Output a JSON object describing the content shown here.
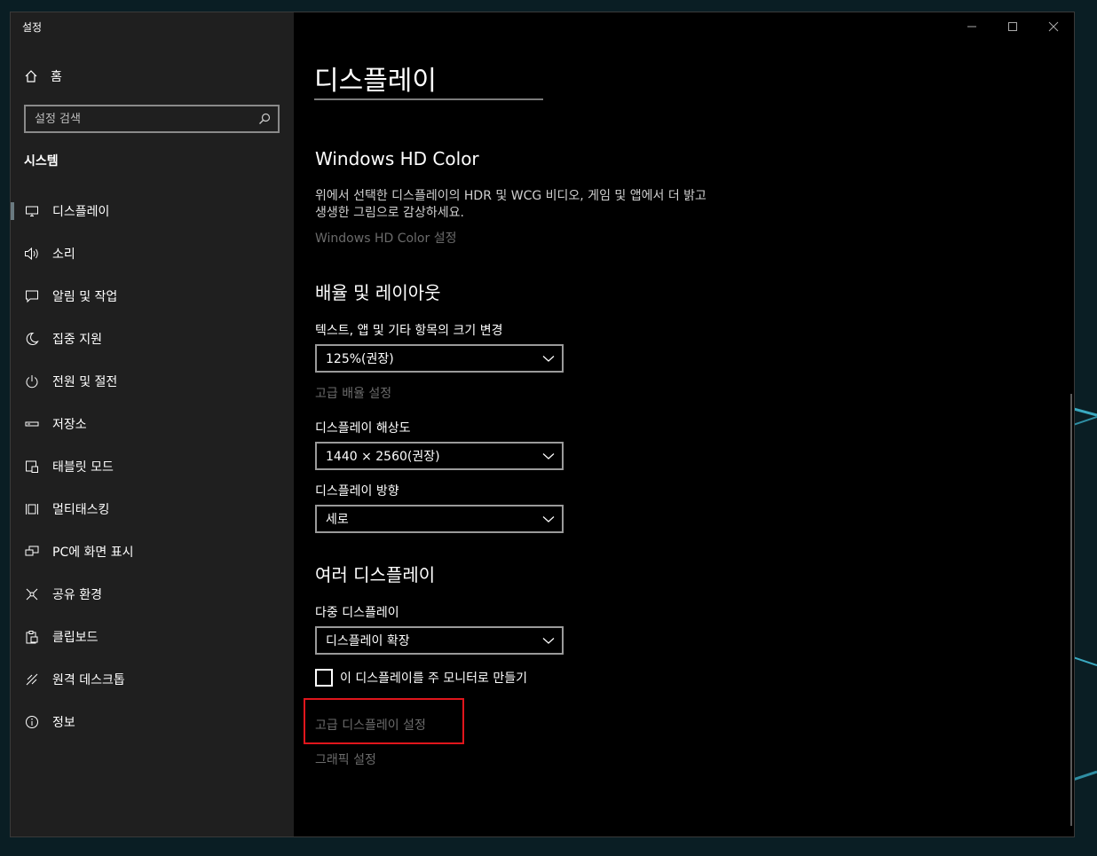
{
  "window": {
    "title": "설정"
  },
  "sidebar": {
    "home_label": "홈",
    "search_placeholder": "설정 검색",
    "section": "시스템",
    "items": [
      {
        "label": "디스플레이",
        "icon": "monitor-icon",
        "active": true
      },
      {
        "label": "소리",
        "icon": "speaker-icon"
      },
      {
        "label": "알림 및 작업",
        "icon": "notification-icon"
      },
      {
        "label": "집중 지원",
        "icon": "moon-icon"
      },
      {
        "label": "전원 및 절전",
        "icon": "power-icon"
      },
      {
        "label": "저장소",
        "icon": "storage-icon"
      },
      {
        "label": "태블릿 모드",
        "icon": "tablet-icon"
      },
      {
        "label": "멀티태스킹",
        "icon": "multitask-icon"
      },
      {
        "label": "PC에 화면 표시",
        "icon": "project-icon"
      },
      {
        "label": "공유 환경",
        "icon": "share-icon"
      },
      {
        "label": "클립보드",
        "icon": "clipboard-icon"
      },
      {
        "label": "원격 데스크톱",
        "icon": "remote-desktop-icon"
      },
      {
        "label": "정보",
        "icon": "info-icon"
      }
    ]
  },
  "main": {
    "title": "디스플레이",
    "hdr": {
      "heading": "Windows HD Color",
      "description": "위에서 선택한 디스플레이의 HDR 및 WCG 비디오, 게임 및 앱에서 더 밝고 생생한 그림으로 감상하세요.",
      "link": "Windows HD Color 설정"
    },
    "scale": {
      "heading": "배율 및 레이아웃",
      "text_size_label": "텍스트, 앱 및 기타 항목의 크기 변경",
      "text_size_value": "125%(권장)",
      "advanced_scaling_link": "고급 배율 설정",
      "resolution_label": "디스플레이 해상도",
      "resolution_value": "1440 × 2560(권장)",
      "orientation_label": "디스플레이 방향",
      "orientation_value": "세로"
    },
    "multi": {
      "heading": "여러 디스플레이",
      "multi_label": "다중 디스플레이",
      "multi_value": "디스플레이 확장",
      "main_display_checkbox": "이 디스플레이를 주 모니터로 만들기",
      "advanced_display_link": "고급 디스플레이 설정",
      "graphics_link": "그래픽 설정"
    }
  },
  "colors": {
    "highlight": "#e0161c",
    "link": "#6b6b6b",
    "sidebar_bg": "#1f1f1f"
  }
}
